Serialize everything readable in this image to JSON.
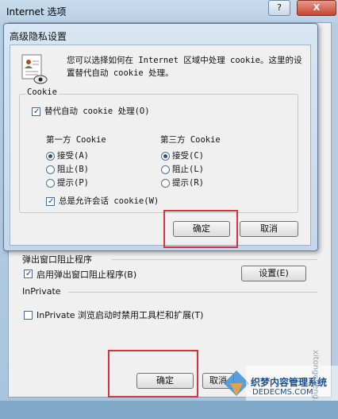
{
  "outer_window": {
    "title": "Internet 选项",
    "help_label": "?",
    "close_label": "X",
    "popup_section": "弹出窗口阻止程序",
    "popup_checkbox": "启用弹出窗口阻止程序(B)",
    "popup_checked": true,
    "settings_button": "设置(E)",
    "inprivate_section": "InPrivate",
    "inprivate_checkbox": "InPrivate 浏览启动时禁用工具栏和扩展(T)",
    "inprivate_checked": false,
    "ok_button": "确定",
    "cancel_button_partial": "取消"
  },
  "dialog": {
    "title": "高级隐私设置",
    "description": "您可以选择如何在 Internet 区域中处理 cookie。这里的设置替代自动 cookie 处理。",
    "group_label": "Cookie",
    "override_label": "替代自动 cookie 处理(O)",
    "override_checked": true,
    "first_party": {
      "title": "第一方 Cookie",
      "options": [
        "接受(A)",
        "阻止(B)",
        "提示(P)"
      ],
      "selected": 0
    },
    "third_party": {
      "title": "第三方 Cookie",
      "options": [
        "接受(C)",
        "阻止(L)",
        "提示(R)"
      ],
      "selected": 0
    },
    "session_label": "总是允许会话 cookie(W)",
    "session_checked": true,
    "ok_button": "确定",
    "cancel_button": "取消"
  },
  "watermark": {
    "name": "织梦内容管理系统",
    "url": "DEDECMS.COM",
    "side_text": "xitongcheng.com"
  },
  "colors": {
    "annotation_red": "#d8323b",
    "title_bar": "#c4d7ea"
  }
}
